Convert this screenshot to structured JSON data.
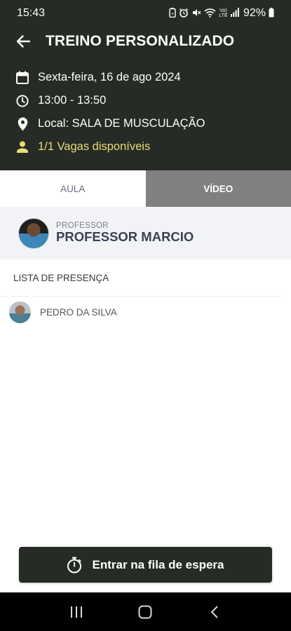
{
  "status_bar": {
    "time": "15:43",
    "battery": "92%",
    "icons": [
      "battery-saver-icon",
      "alarm-icon",
      "mute-icon",
      "wifi-icon",
      "volte-icon",
      "signal-icon",
      "battery-icon"
    ],
    "volte_label": "Vo) LTE"
  },
  "header": {
    "title": "TREINO PERSONALIZADO",
    "date": "Sexta-feira, 16 de ago 2024",
    "time": "13:00 - 13:50",
    "location": "Local: SALA DE MUSCULAÇÃO",
    "vacancies": "1/1 Vagas disponíveis",
    "vacancies_color": "#e9dc76",
    "background": "#262b25"
  },
  "tabs": [
    {
      "label": "AULA",
      "active": true
    },
    {
      "label": "VÍDEO",
      "active": false
    }
  ],
  "professor": {
    "label": "PROFESSOR",
    "name": "PROFESSOR MARCIO"
  },
  "attendance": {
    "title": "LISTA DE PRESENÇA",
    "items": [
      {
        "name": "PEDRO DA SILVA"
      }
    ]
  },
  "cta": {
    "label": "Entrar na fila de espera",
    "icon": "stopwatch-icon"
  },
  "nav": [
    "recent-apps-icon",
    "home-icon",
    "back-nav-icon"
  ]
}
